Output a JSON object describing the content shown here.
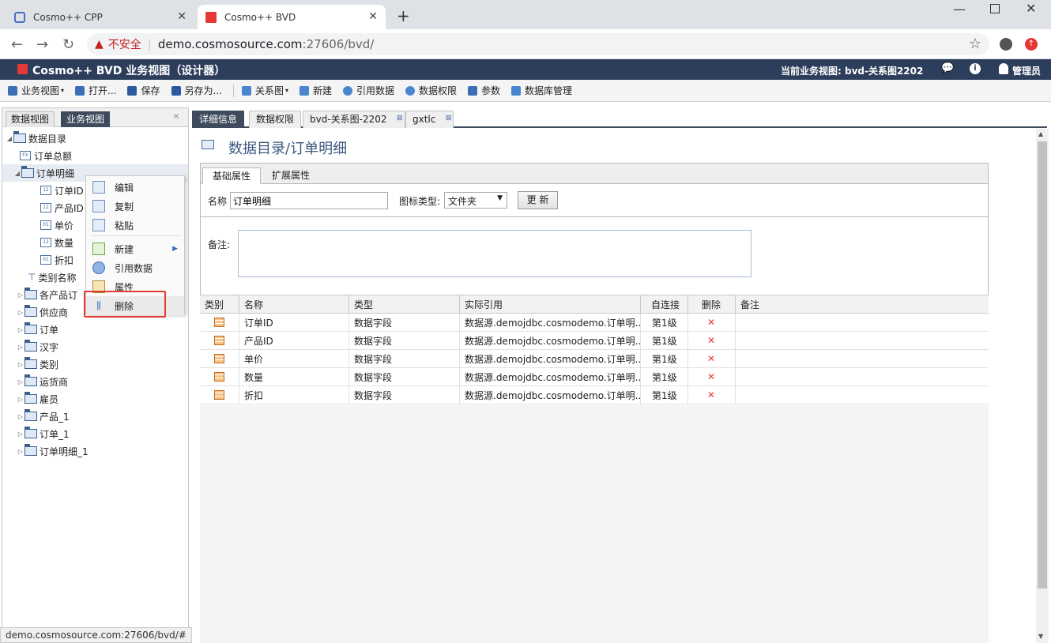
{
  "browser": {
    "tabs": [
      {
        "title": "Cosmo++ CPP"
      },
      {
        "title": "Cosmo++ BVD"
      }
    ],
    "new_tab": "+",
    "insecure_label": "不安全",
    "url_domain": "demo.cosmosource.com",
    "url_rest": ":27606/bvd/",
    "status_url": "demo.cosmosource.com:27606/bvd/#"
  },
  "header": {
    "title": "Cosmo++ BVD 业务视图（设计器）",
    "current_view": "当前业务视图: bvd-关系图2202",
    "user": "管理员"
  },
  "toolbar": {
    "items": [
      "业务视图",
      "打开...",
      "保存",
      "另存为...",
      "关系图",
      "新建",
      "引用数据",
      "数据权限",
      "参数",
      "数据库管理"
    ]
  },
  "left_tabs": [
    "数据视图",
    "业务视图"
  ],
  "tree": {
    "root": "数据目录",
    "order_total": "订单总额",
    "order_detail": "订单明细",
    "fields": [
      "订单ID",
      "产品ID",
      "单价",
      "数量",
      "折扣"
    ],
    "category_name": "类别名称",
    "folders": [
      "各产品订",
      "供应商",
      "订单",
      "汉字",
      "类别",
      "运货商",
      "雇员",
      "产品_1",
      "订单_1",
      "订单明细_1"
    ]
  },
  "context_menu": {
    "items": [
      "编辑",
      "复制",
      "粘贴",
      "新建",
      "引用数据",
      "属性",
      "删除"
    ]
  },
  "main_tabs": [
    "详细信息",
    "数据权限",
    "bvd-关系图-2202",
    "gxtlc"
  ],
  "content": {
    "title": "数据目录/订单明细",
    "prop_tabs": [
      "基础属性",
      "扩展属性"
    ],
    "name_label": "名称",
    "name_value": "订单明细",
    "icon_type_label": "图标类型:",
    "icon_type_value": "文件夹",
    "update_button": "更 新",
    "remark_label": "备注:"
  },
  "grid": {
    "columns": [
      "类别",
      "名称",
      "类型",
      "实际引用",
      "自连接",
      "删除",
      "备注"
    ],
    "rows": [
      {
        "name": "订单ID",
        "type": "数据字段",
        "ref": "数据源.demojdbc.cosmodemo.订单明...",
        "self": "第1级",
        "del": "✕"
      },
      {
        "name": "产品ID",
        "type": "数据字段",
        "ref": "数据源.demojdbc.cosmodemo.订单明...",
        "self": "第1级",
        "del": "✕"
      },
      {
        "name": "单价",
        "type": "数据字段",
        "ref": "数据源.demojdbc.cosmodemo.订单明...",
        "self": "第1级",
        "del": "✕"
      },
      {
        "name": "数量",
        "type": "数据字段",
        "ref": "数据源.demojdbc.cosmodemo.订单明...",
        "self": "第1级",
        "del": "✕"
      },
      {
        "name": "折扣",
        "type": "数据字段",
        "ref": "数据源.demojdbc.cosmodemo.订单明...",
        "self": "第1级",
        "del": "✕"
      }
    ]
  },
  "colors": {
    "header_bg": "#2d3e5c",
    "tab_active": "#3d4b5c",
    "delete_red": "#e53935"
  }
}
